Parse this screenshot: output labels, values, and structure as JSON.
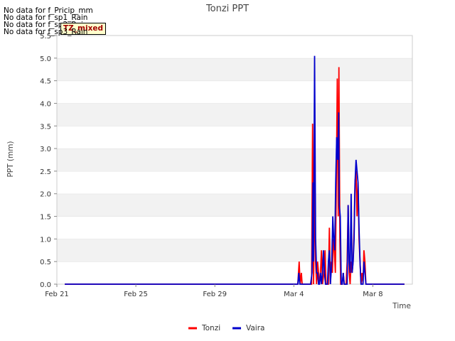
{
  "no_data_messages": [
    "No data for f_Pricip_mm",
    "No data for f_sp1_Rain",
    "No data for f_sp2_Rain",
    "No data for f_sp3_Rain"
  ],
  "badge": "TZ_mixed",
  "chart_data": {
    "type": "line",
    "title": "Tonzi PPT",
    "xlabel": "Time",
    "ylabel": "PPT (mm)",
    "ylim": [
      0,
      5.5
    ],
    "xlim": [
      0,
      18
    ],
    "x_unit": "days after Feb 21",
    "x_ticks": [
      {
        "label": "Feb 21",
        "x": 0
      },
      {
        "label": "Feb 25",
        "x": 4
      },
      {
        "label": "Feb 29",
        "x": 8
      },
      {
        "label": "Mar 4",
        "x": 12
      },
      {
        "label": "Mar 8",
        "x": 16
      }
    ],
    "y_ticks": [
      0.0,
      0.5,
      1.0,
      1.5,
      2.0,
      2.5,
      3.0,
      3.5,
      4.0,
      4.5,
      5.0,
      5.5
    ],
    "y_tick_labels": [
      "0.0",
      "0.5",
      "1.0",
      "1.5",
      "2.0",
      "2.5",
      "3.0",
      "3.5",
      "4.0",
      "4.5",
      "5.0",
      "5.5"
    ],
    "grid": "horizontal bands",
    "legend_position": "bottom-center",
    "series": [
      {
        "name": "Tonzi",
        "color": "#ff0000",
        "points": [
          [
            0.4,
            0
          ],
          [
            12.2,
            0
          ],
          [
            12.27,
            0.5
          ],
          [
            12.32,
            0
          ],
          [
            12.38,
            0.25
          ],
          [
            12.42,
            0
          ],
          [
            12.9,
            0
          ],
          [
            12.95,
            3.55
          ],
          [
            13.0,
            0
          ],
          [
            13.05,
            2.25
          ],
          [
            13.1,
            0.5
          ],
          [
            13.15,
            0
          ],
          [
            13.2,
            0.5
          ],
          [
            13.25,
            0.25
          ],
          [
            13.3,
            0
          ],
          [
            13.35,
            0.25
          ],
          [
            13.4,
            0.75
          ],
          [
            13.45,
            0
          ],
          [
            13.52,
            0.25
          ],
          [
            13.58,
            0.75
          ],
          [
            13.63,
            0
          ],
          [
            13.75,
            0
          ],
          [
            13.8,
            1.25
          ],
          [
            13.85,
            0
          ],
          [
            13.9,
            0.5
          ],
          [
            13.95,
            0.25
          ],
          [
            14.0,
            1.0
          ],
          [
            14.05,
            0.75
          ],
          [
            14.1,
            0.25
          ],
          [
            14.15,
            2.25
          ],
          [
            14.2,
            4.55
          ],
          [
            14.25,
            1.5
          ],
          [
            14.28,
            4.8
          ],
          [
            14.33,
            1.0
          ],
          [
            14.37,
            0
          ],
          [
            14.45,
            0
          ],
          [
            14.5,
            0.25
          ],
          [
            14.55,
            0
          ],
          [
            14.65,
            0
          ],
          [
            14.7,
            0.5
          ],
          [
            14.75,
            1.75
          ],
          [
            14.8,
            0.25
          ],
          [
            14.85,
            0
          ],
          [
            14.9,
            0.5
          ],
          [
            14.95,
            0.25
          ],
          [
            15.0,
            0.5
          ],
          [
            15.05,
            1.25
          ],
          [
            15.1,
            2.25
          ],
          [
            15.15,
            2.5
          ],
          [
            15.2,
            1.5
          ],
          [
            15.25,
            2.25
          ],
          [
            15.3,
            1.0
          ],
          [
            15.35,
            0.5
          ],
          [
            15.4,
            0
          ],
          [
            15.45,
            0.25
          ],
          [
            15.5,
            0
          ],
          [
            15.55,
            0.75
          ],
          [
            15.6,
            0.5
          ],
          [
            15.65,
            0
          ],
          [
            17.6,
            0
          ]
        ]
      },
      {
        "name": "Vaira",
        "color": "#0000cc",
        "points": [
          [
            0.4,
            0
          ],
          [
            12.2,
            0
          ],
          [
            12.25,
            0.25
          ],
          [
            12.3,
            0
          ],
          [
            12.85,
            0
          ],
          [
            12.92,
            0.25
          ],
          [
            12.97,
            2.25
          ],
          [
            13.0,
            0.5
          ],
          [
            13.05,
            5.05
          ],
          [
            13.1,
            1.0
          ],
          [
            13.15,
            0.25
          ],
          [
            13.2,
            0.25
          ],
          [
            13.25,
            0
          ],
          [
            13.3,
            0
          ],
          [
            13.35,
            0.25
          ],
          [
            13.4,
            0
          ],
          [
            13.45,
            0.25
          ],
          [
            13.5,
            0.75
          ],
          [
            13.55,
            0.25
          ],
          [
            13.6,
            0
          ],
          [
            13.7,
            0
          ],
          [
            13.75,
            0.5
          ],
          [
            13.8,
            0.75
          ],
          [
            13.85,
            0
          ],
          [
            13.92,
            0.5
          ],
          [
            13.97,
            1.5
          ],
          [
            14.02,
            1.0
          ],
          [
            14.07,
            0.75
          ],
          [
            14.12,
            2.25
          ],
          [
            14.17,
            3.25
          ],
          [
            14.22,
            2.75
          ],
          [
            14.27,
            3.8
          ],
          [
            14.3,
            1.75
          ],
          [
            14.35,
            1.5
          ],
          [
            14.4,
            0
          ],
          [
            14.45,
            0
          ],
          [
            14.5,
            0.25
          ],
          [
            14.55,
            0
          ],
          [
            14.7,
            0
          ],
          [
            14.75,
            1.75
          ],
          [
            14.8,
            0.5
          ],
          [
            14.85,
            0.25
          ],
          [
            14.9,
            2.0
          ],
          [
            14.95,
            0.25
          ],
          [
            15.0,
            0.5
          ],
          [
            15.05,
            1.0
          ],
          [
            15.1,
            2.25
          ],
          [
            15.15,
            2.75
          ],
          [
            15.2,
            2.5
          ],
          [
            15.25,
            2.25
          ],
          [
            15.3,
            1.25
          ],
          [
            15.35,
            0.5
          ],
          [
            15.4,
            0
          ],
          [
            15.5,
            0
          ],
          [
            15.55,
            0.5
          ],
          [
            15.6,
            0.25
          ],
          [
            15.65,
            0
          ],
          [
            17.6,
            0
          ]
        ]
      }
    ]
  }
}
